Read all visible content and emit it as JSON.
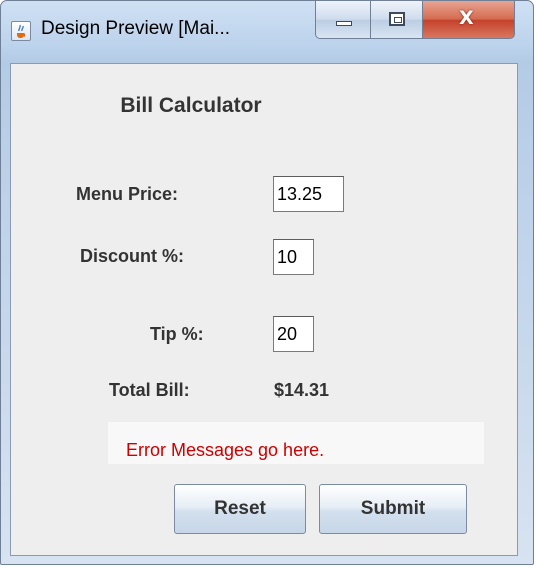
{
  "window": {
    "title": "Design Preview [Mai...",
    "minimize_icon": "minimize-icon",
    "maximize_icon": "maximize-icon",
    "close_icon": "close-icon",
    "close_glyph": "X",
    "app_icon": "java-cup-icon"
  },
  "form": {
    "heading": "Bill Calculator",
    "menu_price": {
      "label": "Menu Price:",
      "value": "13.25"
    },
    "discount": {
      "label": "Discount %:",
      "value": "10"
    },
    "tip": {
      "label": "Tip %:",
      "value": "20"
    },
    "total": {
      "label": "Total Bill:",
      "value": "$14.31"
    },
    "error_message": "Error Messages go here.",
    "reset_label": "Reset",
    "submit_label": "Submit"
  },
  "colors": {
    "error_text": "#cc0000",
    "panel_background": "#eeeeee",
    "close_button": "#c4402a"
  }
}
